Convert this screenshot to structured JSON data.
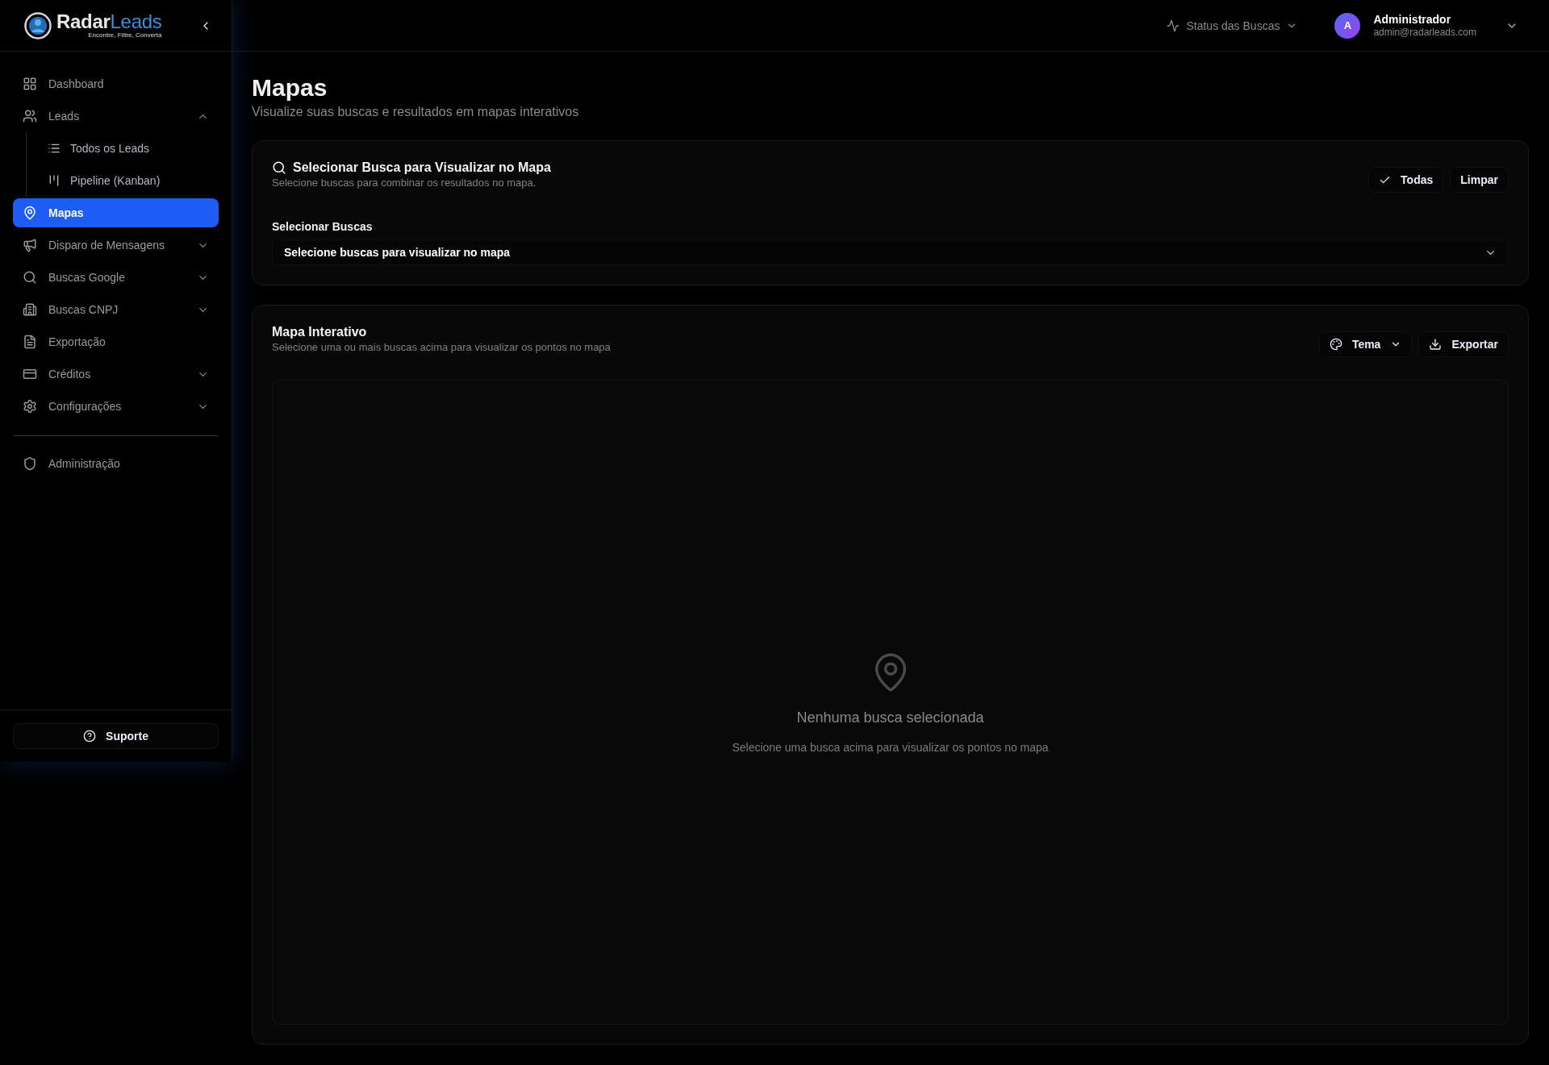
{
  "brand": {
    "name_part_1": "Radar",
    "name_part_2": "Leads",
    "tagline": "Encontre, Filtre, Converta"
  },
  "sidebar": {
    "items": [
      {
        "label": "Dashboard",
        "kind": "link",
        "selected": false
      },
      {
        "label": "Leads",
        "kind": "group",
        "expanded": true,
        "selected": false,
        "children": [
          {
            "label": "Todos os Leads",
            "selected": false
          },
          {
            "label": "Pipeline (Kanban)",
            "selected": false
          }
        ]
      },
      {
        "label": "Mapas",
        "kind": "link",
        "selected": true
      },
      {
        "label": "Disparo de Mensagens",
        "kind": "group",
        "expanded": false,
        "selected": false
      },
      {
        "label": "Buscas Google",
        "kind": "group",
        "expanded": false,
        "selected": false
      },
      {
        "label": "Buscas CNPJ",
        "kind": "group",
        "expanded": false,
        "selected": false
      },
      {
        "label": "Exportação",
        "kind": "link",
        "selected": false
      },
      {
        "label": "Créditos",
        "kind": "group",
        "expanded": false,
        "selected": false
      },
      {
        "label": "Configurações",
        "kind": "group",
        "expanded": false,
        "selected": false
      }
    ],
    "admin_items": [
      {
        "label": "Administração",
        "selected": false
      }
    ],
    "support_button": "Suporte"
  },
  "header": {
    "status_menu": "Status das Buscas",
    "user": {
      "initial": "A",
      "name": "Administrador",
      "email": "admin@radarleads.com"
    }
  },
  "page": {
    "title": "Mapas",
    "subtitle": "Visualize suas buscas e resultados em mapas interativos"
  },
  "search_card": {
    "title": "Selecionar Busca para Visualizar no Mapa",
    "description": "Selecione buscas para combinar os resultados no mapa.",
    "buttons": [
      "Todas",
      "Limpar"
    ],
    "field_label": "Selecionar Buscas",
    "select_placeholder": "Selecione buscas para visualizar no mapa"
  },
  "map_card": {
    "title": "Mapa Interativo",
    "description": "Selecione uma ou mais buscas acima para visualizar os pontos no mapa",
    "theme_button": "Tema",
    "export_button": "Exportar",
    "empty_title": "Nenhuma busca selecionada",
    "empty_text": "Selecione uma busca acima para visualizar os pontos no mapa"
  }
}
